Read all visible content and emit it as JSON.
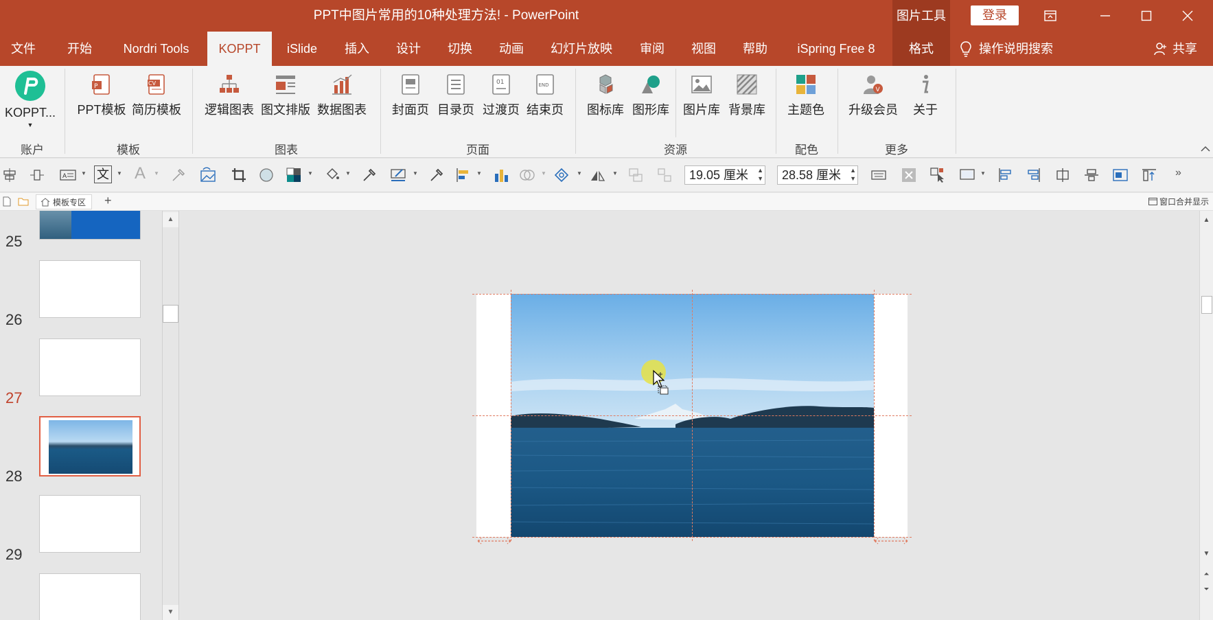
{
  "app": {
    "title": "PPT中图片常用的10种处理方法!  -  PowerPoint",
    "context_label": "图片工具",
    "login": "登录"
  },
  "tabs": [
    {
      "label": "文件"
    },
    {
      "label": "开始"
    },
    {
      "label": "Nordri Tools"
    },
    {
      "label": "KOPPT"
    },
    {
      "label": "iSlide"
    },
    {
      "label": "插入"
    },
    {
      "label": "设计"
    },
    {
      "label": "切换"
    },
    {
      "label": "动画"
    },
    {
      "label": "幻灯片放映"
    },
    {
      "label": "审阅"
    },
    {
      "label": "视图"
    },
    {
      "label": "帮助"
    },
    {
      "label": "iSpring Free 8"
    },
    {
      "label": "格式"
    }
  ],
  "tell_me": "操作说明搜索",
  "share": "共享",
  "ribbon": {
    "koppt": "KOPPT...",
    "groups": {
      "account": "账户",
      "template": "模板",
      "chart": "图表",
      "page": "页面",
      "resource": "资源",
      "color": "配色",
      "more": "更多"
    },
    "buttons": {
      "ppt_template": "PPT模板",
      "resume_template": "简历模板",
      "logic_chart": "逻辑图表",
      "text_layout": "图文排版",
      "data_chart": "数据图表",
      "cover": "封面页",
      "toc": "目录页",
      "transition": "过渡页",
      "end": "结束页",
      "icon_lib": "图标库",
      "shape_lib": "图形库",
      "picture_lib": "图片库",
      "background_lib": "背景库",
      "theme_color": "主题色",
      "upgrade": "升级会员",
      "about": "关于"
    }
  },
  "format_bar": {
    "height_value": "19.05 厘米",
    "width_value": "28.58 厘米",
    "text_glyph": "文",
    "font_glyph": "A"
  },
  "doc_strip": {
    "tab_label": "模板专区",
    "add": "+",
    "merge": "窗口合并显示"
  },
  "slides": [
    {
      "number": "25"
    },
    {
      "number": "26"
    },
    {
      "number": "27"
    },
    {
      "number": "28"
    },
    {
      "number": "29"
    }
  ],
  "colors": {
    "accent": "#b7472a",
    "accent_dark": "#9d3a20",
    "selected_border": "#e15e43"
  }
}
